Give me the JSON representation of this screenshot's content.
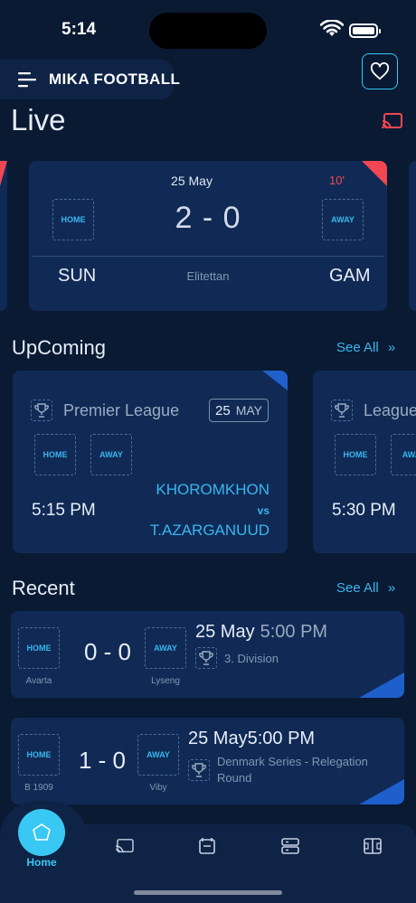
{
  "status_bar": {
    "time": "5:14"
  },
  "header": {
    "title": "MIKA FOOTBALL"
  },
  "colors": {
    "accent": "#39c8f3",
    "live_red": "#f04753",
    "card": "#102a55",
    "background": "#0a1a33"
  },
  "live": {
    "title": "Live",
    "match": {
      "date": "25 May",
      "minute": "10'",
      "home_badge": "HOME",
      "away_badge": "AWAY",
      "score": "2 - 0",
      "home_team": "SUN",
      "league": "Elitettan",
      "away_team": "GAM"
    }
  },
  "upcoming": {
    "title": "UpComing",
    "see_all": "See All",
    "matches": [
      {
        "league": "Premier League",
        "day": "25",
        "month": "MAY",
        "home_badge": "HOME",
        "away_badge": "AWAY",
        "time": "5:15 PM",
        "home_team": "KHOROMKHON",
        "vs": "vs",
        "away_team": "T.AZARGANUUD"
      },
      {
        "league": "League",
        "home_badge": "HOME",
        "away_badge": "AWA",
        "time": "5:30 PM"
      }
    ]
  },
  "recent": {
    "title": "Recent",
    "see_all": "See All",
    "matches": [
      {
        "home_badge": "HOME",
        "home_team": "Avarta",
        "score": "0 - 0",
        "away_badge": "AWAY",
        "away_team": "Lyseng",
        "date": "25 May",
        "time": "5:00 PM",
        "league": "3. Division"
      },
      {
        "home_badge": "HOME",
        "home_team": "B 1909",
        "score": "1 - 0",
        "away_badge": "AWAY",
        "away_team": "Viby",
        "date": "25 May",
        "time": "5:00 PM",
        "league": "Denmark Series - Relegation Round"
      }
    ]
  },
  "tabbar": {
    "home_label": "Home",
    "icons": [
      "home-icon",
      "cast-icon",
      "news-icon",
      "standings-icon",
      "field-icon"
    ]
  }
}
